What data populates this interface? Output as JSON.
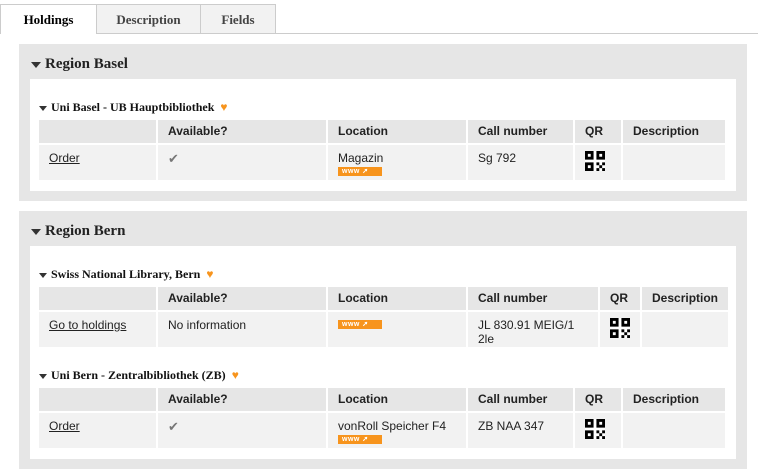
{
  "tabs": [
    {
      "label": "Holdings",
      "active": true
    },
    {
      "label": "Description",
      "active": false
    },
    {
      "label": "Fields",
      "active": false
    }
  ],
  "columns": {
    "available": "Available?",
    "location": "Location",
    "call_number": "Call number",
    "qr": "QR",
    "description": "Description"
  },
  "www_label": "www",
  "check_icon": "checkmark-icon",
  "regions": [
    {
      "title": "Region Basel",
      "libraries": [
        {
          "name": "Uni Basel - UB Hauptbibliothek",
          "rows": [
            {
              "action": "Order",
              "available": "",
              "available_icon": "checkmark",
              "location": "Magazin",
              "call_number": "Sg 792",
              "description": ""
            }
          ]
        }
      ]
    },
    {
      "title": "Region Bern",
      "libraries": [
        {
          "name": "Swiss National Library, Bern",
          "rows": [
            {
              "action": "Go to holdings",
              "available": "No information",
              "location": "",
              "call_number": "JL 830.91 MEIG/1 2le",
              "description": ""
            }
          ]
        },
        {
          "name": "Uni Bern - Zentralbibliothek (ZB)",
          "rows": [
            {
              "action": "Order",
              "available": "",
              "available_icon": "checkmark",
              "location": "vonRoll Speicher F4",
              "call_number": "ZB NAA 347",
              "description": ""
            }
          ]
        }
      ]
    }
  ],
  "colors": {
    "accent": "#f7941d",
    "panel": "#e6e6e6",
    "row": "#f2f2f2"
  }
}
